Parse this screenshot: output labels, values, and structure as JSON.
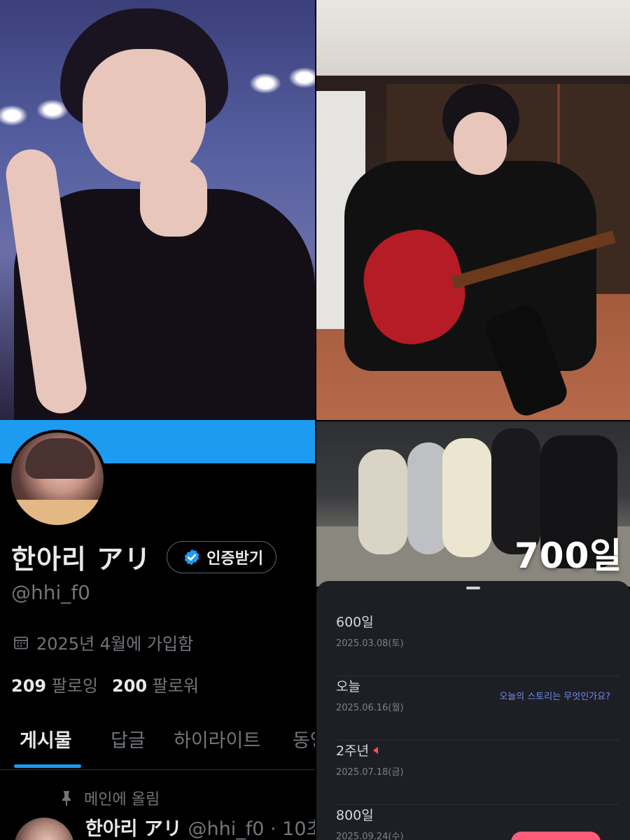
{
  "profile": {
    "display_name": "한아리 アリ",
    "verify_label": "인증받기",
    "handle": "@hhi_f0",
    "joined": "2025년 4월에 가입함",
    "following_count": "209",
    "following_label": "팔로잉",
    "followers_count": "200",
    "followers_label": "팔로워",
    "tabs": [
      "게시물",
      "답글",
      "하이라이트",
      "동영"
    ],
    "pinned_label": "메인에 올림",
    "post_meta": "@hhi_f0 · 10초"
  },
  "overlay": {
    "day_counter": "700일"
  },
  "anniversaries": [
    {
      "title": "600일",
      "date": "2025.03.08(토)"
    },
    {
      "title": "오늘",
      "date": "2025.06.16(월)",
      "prompt": "오늘의 스토리는 무엇인가요?"
    },
    {
      "title": "2주년",
      "date": "2025.07.18(금)"
    },
    {
      "title": "800일",
      "date": "2025.09.24(수)"
    }
  ],
  "colors": {
    "accent": "#1d9bf0",
    "muted_text": "#71767b",
    "anniv_prompt": "#6b8cf0",
    "marker": "#ff4d5e"
  },
  "icons": [
    "verified-badge-icon",
    "calendar-icon",
    "pin-icon",
    "red-marker-icon"
  ]
}
